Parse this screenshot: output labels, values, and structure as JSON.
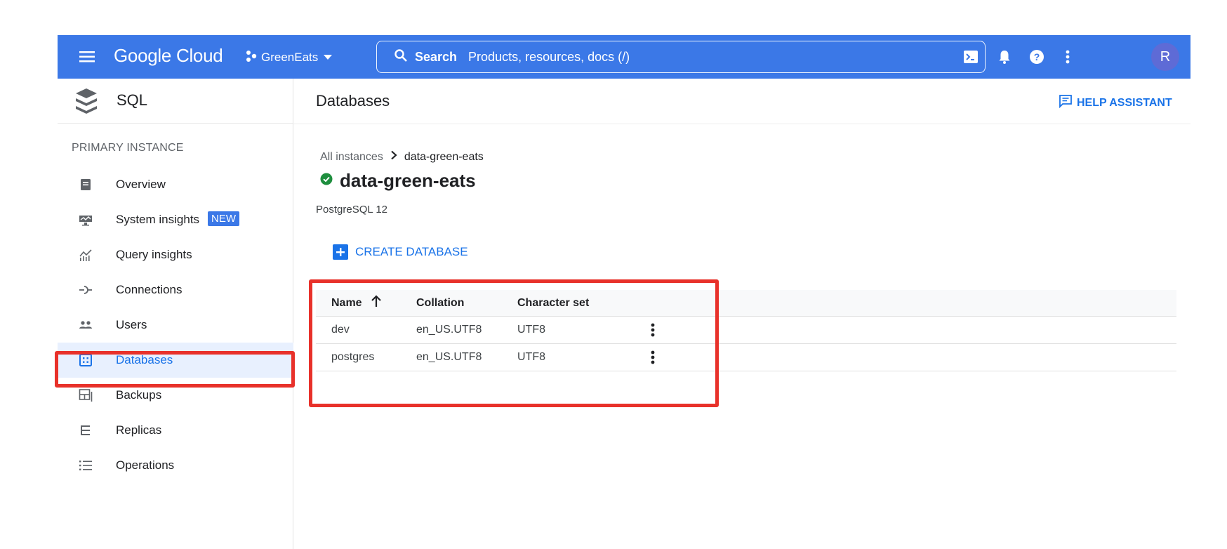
{
  "topbar": {
    "logo": "Google Cloud",
    "project": "GreenEats",
    "search_label": "Search",
    "search_placeholder": "Products, resources, docs (/)",
    "avatar_letter": "R"
  },
  "sidebar": {
    "product": "SQL",
    "section": "PRIMARY INSTANCE",
    "items": [
      {
        "label": "Overview",
        "icon": "overview-icon"
      },
      {
        "label": "System insights",
        "icon": "system-insights-icon",
        "badge": "NEW"
      },
      {
        "label": "Query insights",
        "icon": "query-insights-icon"
      },
      {
        "label": "Connections",
        "icon": "connections-icon"
      },
      {
        "label": "Users",
        "icon": "users-icon"
      },
      {
        "label": "Databases",
        "icon": "databases-icon",
        "active": true
      },
      {
        "label": "Backups",
        "icon": "backups-icon"
      },
      {
        "label": "Replicas",
        "icon": "replicas-icon"
      },
      {
        "label": "Operations",
        "icon": "operations-icon"
      }
    ]
  },
  "main": {
    "title": "Databases",
    "help_assistant": "HELP ASSISTANT",
    "breadcrumb": {
      "root": "All instances",
      "current": "data-green-eats"
    },
    "instance": {
      "name": "data-green-eats",
      "version": "PostgreSQL 12",
      "status": "running"
    },
    "create_button": "CREATE DATABASE"
  },
  "table": {
    "headers": {
      "name": "Name",
      "collation": "Collation",
      "charset": "Character set"
    },
    "rows": [
      {
        "name": "dev",
        "collation": "en_US.UTF8",
        "charset": "UTF8"
      },
      {
        "name": "postgres",
        "collation": "en_US.UTF8",
        "charset": "UTF8"
      }
    ]
  },
  "colors": {
    "topbar": "#3b78e7",
    "accent": "#1a73e8",
    "highlight": "#e8312a",
    "status_ok": "#1e8e3e"
  }
}
